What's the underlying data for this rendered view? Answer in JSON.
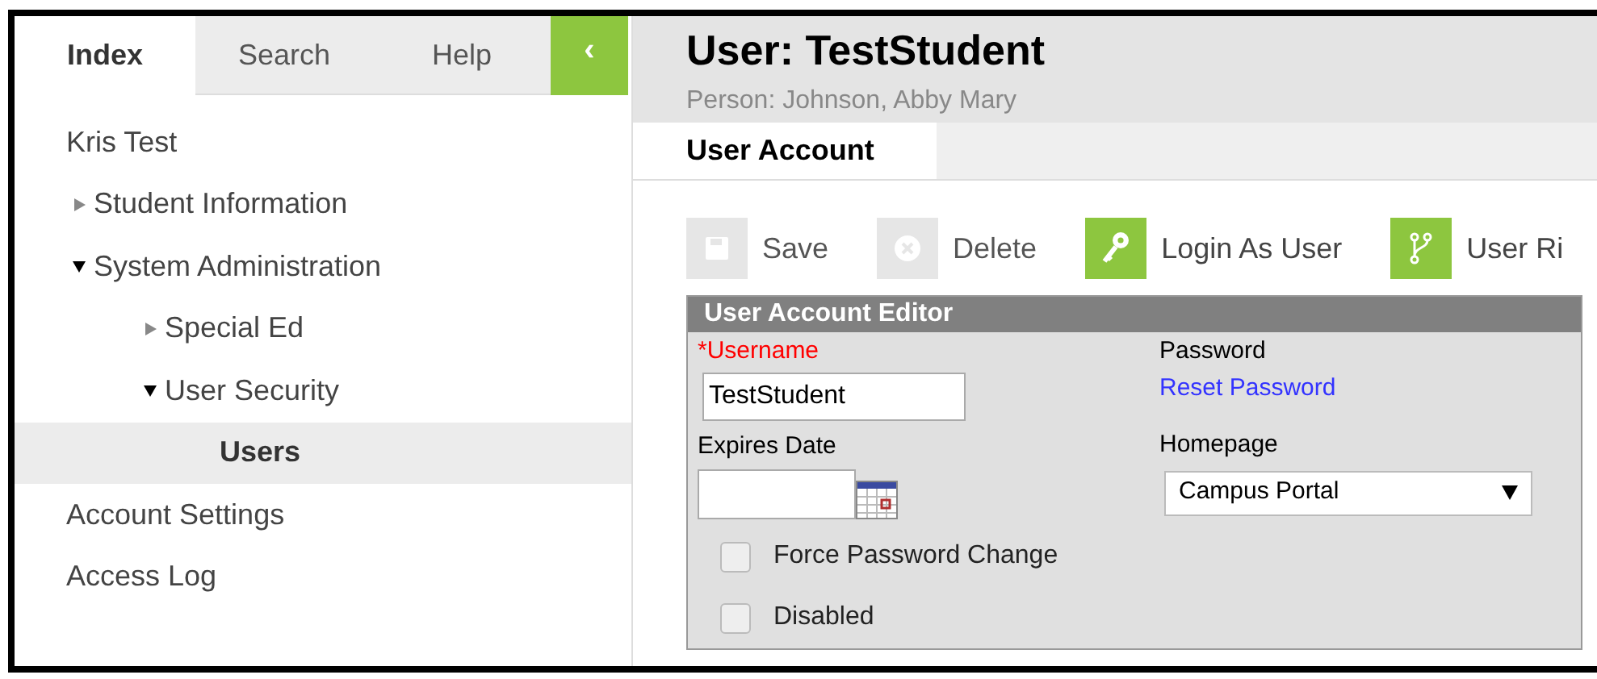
{
  "sidebar": {
    "tabs": [
      {
        "label": "Index",
        "selected": true
      },
      {
        "label": "Search",
        "selected": false
      },
      {
        "label": "Help",
        "selected": false
      }
    ],
    "collapse_button": {
      "label": "‹"
    },
    "tree": [
      {
        "label": "Kris Test",
        "kind": "link",
        "selected": false
      },
      {
        "label": "Student Information",
        "kind": "folder",
        "expanded": false,
        "selected": false
      },
      {
        "label": "System Administration",
        "kind": "folder",
        "expanded": true,
        "selected": false,
        "children": [
          {
            "label": "Special Ed",
            "kind": "folder",
            "expanded": false,
            "selected": false
          },
          {
            "label": "User Security",
            "kind": "folder",
            "expanded": true,
            "selected": false,
            "children": [
              {
                "label": "Users",
                "kind": "link",
                "selected": true
              }
            ]
          }
        ]
      },
      {
        "label": "Account Settings",
        "kind": "link",
        "selected": false
      },
      {
        "label": "Access Log",
        "kind": "link",
        "selected": false
      }
    ]
  },
  "header": {
    "title": "User: TestStudent",
    "subtitle": "Person: Johnson, Abby Mary"
  },
  "tabs": [
    {
      "label": "User Account",
      "selected": true
    }
  ],
  "toolbar": [
    {
      "label": "Save",
      "kind": "save",
      "disabled": true
    },
    {
      "label": "Delete",
      "kind": "delete",
      "disabled": true
    },
    {
      "label": "Login As User",
      "kind": "key",
      "disabled": false
    },
    {
      "label": "User Ri",
      "kind": "branch",
      "disabled": false
    }
  ],
  "editor": {
    "title": "User Account Editor",
    "username": {
      "required_mark": "*",
      "label": "Username",
      "value": "TestStudent"
    },
    "password": {
      "label": "Password",
      "link": "Reset Password"
    },
    "expires": {
      "label": "Expires Date"
    },
    "homepage": {
      "label": "Homepage",
      "value": "Campus Portal"
    },
    "checkboxes": [
      {
        "label": "Force Password Change",
        "checked": false
      },
      {
        "label": "Disabled",
        "checked": false
      }
    ]
  }
}
